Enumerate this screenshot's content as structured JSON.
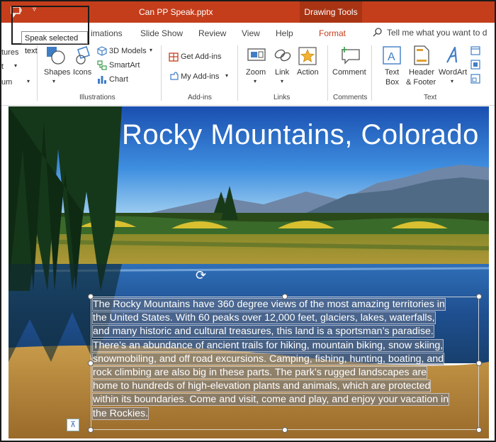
{
  "window": {
    "title": "Can PP Speak.pptx",
    "contextual_tab": "Drawing Tools",
    "qat_more": "▿"
  },
  "tooltip": "Speak selected text",
  "tabs": [
    "imations",
    "Slide Show",
    "Review",
    "View",
    "Help",
    "Format"
  ],
  "tell_me": "Tell me what you want to d",
  "ribbon": {
    "partial_items": [
      "tures",
      "t",
      "um"
    ],
    "illustrations": {
      "shapes": "Shapes",
      "icons": "Icons",
      "models_3d": "3D Models",
      "smartart": "SmartArt",
      "chart": "Chart",
      "label": "Illustrations"
    },
    "addins": {
      "get": "Get Add-ins",
      "my": "My Add-ins",
      "label": "Add-ins"
    },
    "links": {
      "zoom": "Zoom",
      "link": "Link",
      "action": "Action",
      "label": "Links"
    },
    "comments": {
      "comment": "Comment",
      "label": "Comments"
    },
    "text": {
      "textbox_l1": "Text",
      "textbox_l2": "Box",
      "header_l1": "Header",
      "header_l2": "& Footer",
      "wordart": "WordArt",
      "label": "Text"
    }
  },
  "slide": {
    "title": "Rocky Mountains, Colorado",
    "body_lines": [
      "The Rocky Mountains have 360 degree views of the most amazing  territories in",
      "the United States. With 60 peaks over 12,000 feet, glaciers, lakes, waterfalls,",
      "and many historic and cultural treasures, this land is a sportsman’s paradise.",
      "There’s an abundance of ancient trails for hiking, mountain biking, snow skiing,",
      "snowmobiling, and off road excursions. Camping, fishing, hunting, boating, and",
      "rock climbing are also big in these parts. The park’s rugged landscapes are",
      "home to hundreds of high-elevation plants and animals, which are protected",
      "within its boundaries. Come and visit, come and play, and enjoy your vacation in",
      "the Rockies."
    ]
  },
  "colors": {
    "accent": "#c43e1c",
    "contextual": "#a93414"
  }
}
